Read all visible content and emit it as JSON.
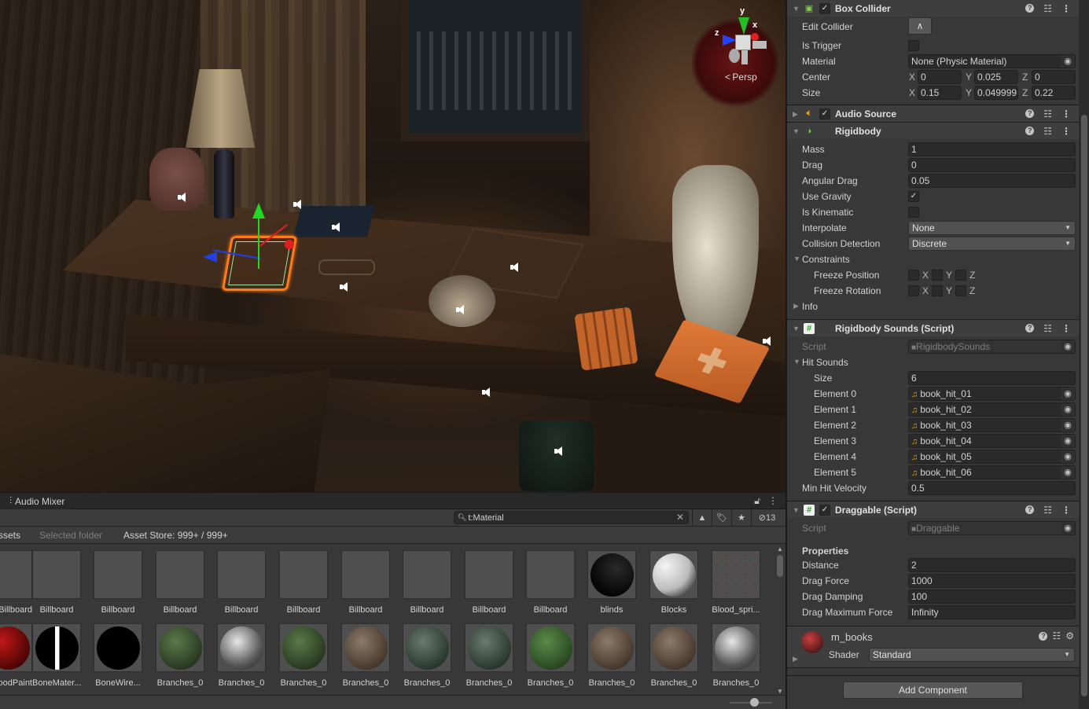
{
  "scene": {
    "view_mode_label": "Persp",
    "axis_labels": {
      "x": "x",
      "y": "y",
      "z": "z"
    }
  },
  "project": {
    "tab_label": "Audio Mixer",
    "search_value": "t:Material",
    "hidden_count": "13",
    "filters": {
      "assets": "Assets",
      "selected_folder": "Selected folder",
      "asset_store": "Asset Store: 999+ / 999+"
    },
    "row1": [
      "Billboard",
      "Billboard",
      "Billboard",
      "Billboard",
      "Billboard",
      "Billboard",
      "Billboard",
      "Billboard",
      "Billboard",
      "Billboard",
      "blinds",
      "Blocks",
      "Blood_spri..."
    ],
    "row2": [
      "BloodPaint",
      "BoneMater...",
      "BoneWire...",
      "Branches_0",
      "Branches_0",
      "Branches_0",
      "Branches_0",
      "Branches_0",
      "Branches_0",
      "Branches_0",
      "Branches_0",
      "Branches_0",
      "Branches_0"
    ]
  },
  "inspector": {
    "box_collider": {
      "title": "Box Collider",
      "enabled": true,
      "edit_collider_label": "Edit Collider",
      "is_trigger_label": "Is Trigger",
      "is_trigger": false,
      "material_label": "Material",
      "material_value": "None (Physic Material)",
      "center_label": "Center",
      "center": {
        "x": "0",
        "y": "0.025",
        "z": "0"
      },
      "size_label": "Size",
      "size": {
        "x": "0.15",
        "y": "0.049999",
        "z": "0.22"
      }
    },
    "audio_source": {
      "title": "Audio Source",
      "enabled": true
    },
    "rigidbody": {
      "title": "Rigidbody",
      "mass_label": "Mass",
      "mass": "1",
      "drag_label": "Drag",
      "drag": "0",
      "angular_drag_label": "Angular Drag",
      "angular_drag": "0.05",
      "use_gravity_label": "Use Gravity",
      "use_gravity": true,
      "is_kinematic_label": "Is Kinematic",
      "is_kinematic": false,
      "interpolate_label": "Interpolate",
      "interpolate": "None",
      "collision_detection_label": "Collision Detection",
      "collision_detection": "Discrete",
      "constraints_label": "Constraints",
      "freeze_position_label": "Freeze Position",
      "freeze_rotation_label": "Freeze Rotation",
      "axis_x": "X",
      "axis_y": "Y",
      "axis_z": "Z",
      "info_label": "Info"
    },
    "rigidbody_sounds": {
      "title": "Rigidbody Sounds (Script)",
      "script_label": "Script",
      "script_value": "RigidbodySounds",
      "hit_sounds_label": "Hit Sounds",
      "size_label": "Size",
      "size": "6",
      "elements": [
        {
          "label": "Element 0",
          "value": "book_hit_01"
        },
        {
          "label": "Element 1",
          "value": "book_hit_02"
        },
        {
          "label": "Element 2",
          "value": "book_hit_03"
        },
        {
          "label": "Element 3",
          "value": "book_hit_04"
        },
        {
          "label": "Element 4",
          "value": "book_hit_05"
        },
        {
          "label": "Element 5",
          "value": "book_hit_06"
        }
      ],
      "min_hit_velocity_label": "Min Hit Velocity",
      "min_hit_velocity": "0.5"
    },
    "draggable": {
      "title": "Draggable (Script)",
      "enabled": true,
      "script_label": "Script",
      "script_value": "Draggable",
      "properties_label": "Properties",
      "distance_label": "Distance",
      "distance": "2",
      "drag_force_label": "Drag Force",
      "drag_force": "1000",
      "drag_damping_label": "Drag Damping",
      "drag_damping": "100",
      "drag_max_force_label": "Drag Maximum Force",
      "drag_max_force": "Infinity"
    },
    "material": {
      "name": "m_books",
      "shader_label": "Shader",
      "shader_value": "Standard"
    },
    "add_component_label": "Add Component"
  },
  "colors": {
    "selection_outline": "#ff7a18",
    "axis_x": "#e02020",
    "axis_y": "#22d622",
    "axis_z": "#2040e0",
    "audio_clip_icon": "#e8a000"
  }
}
